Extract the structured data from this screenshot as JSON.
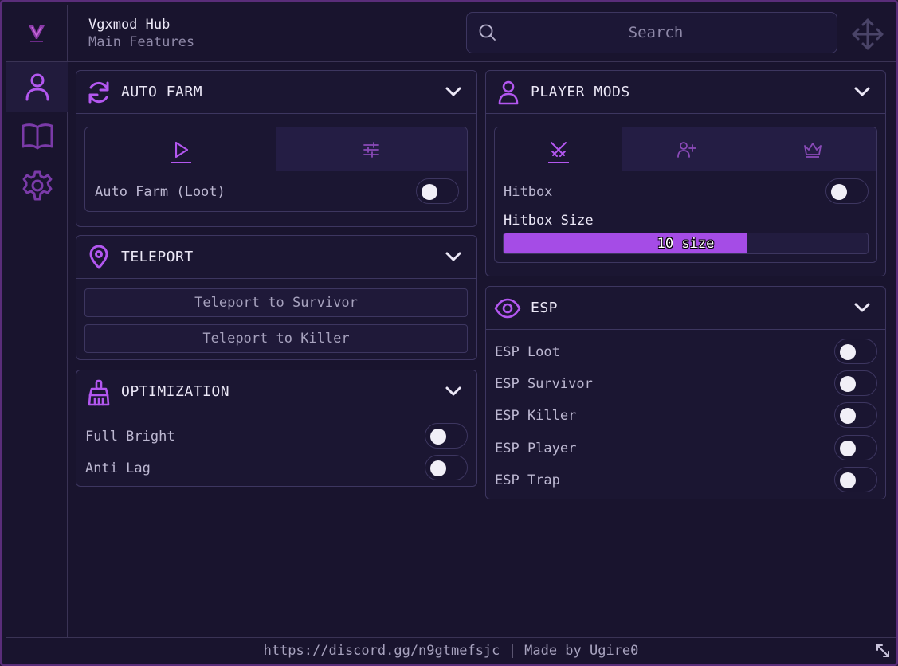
{
  "app": {
    "title": "Vgxmod Hub",
    "subtitle": "Main Features",
    "search_placeholder": "Search",
    "logo_text": "VGXMOD"
  },
  "sidebar": [
    {
      "icon": "user-icon",
      "active": true
    },
    {
      "icon": "book-icon",
      "active": false
    },
    {
      "icon": "gear-icon",
      "active": false
    }
  ],
  "auto_farm": {
    "title": "AUTO FARM",
    "toggle_label": "Auto Farm (Loot)",
    "toggle_on": false
  },
  "teleport": {
    "title": "TELEPORT",
    "btn_survivor": "Teleport to Survivor",
    "btn_killer": "Teleport to Killer"
  },
  "optimization": {
    "title": "OPTIMIZATION",
    "items": [
      {
        "label": "Full Bright",
        "on": false
      },
      {
        "label": "Anti Lag",
        "on": false
      }
    ]
  },
  "player_mods": {
    "title": "PLAYER MODS",
    "hitbox_label": "Hitbox",
    "hitbox_on": false,
    "size_label": "Hitbox Size",
    "size_value_text": "10 size",
    "size_fraction": 0.67
  },
  "esp": {
    "title": "ESP",
    "items": [
      {
        "label": "ESP Loot",
        "on": false
      },
      {
        "label": "ESP Survivor",
        "on": false
      },
      {
        "label": "ESP Killer",
        "on": false
      },
      {
        "label": "ESP Player",
        "on": false
      },
      {
        "label": "ESP Trap",
        "on": false
      }
    ]
  },
  "footer": {
    "text": "https://discord.gg/n9gtmefsjc | Made by Ugire0"
  },
  "colors": {
    "accent": "#b357f0",
    "background": "#19142e",
    "panel": "#1b1632",
    "border": "#3d3660"
  }
}
